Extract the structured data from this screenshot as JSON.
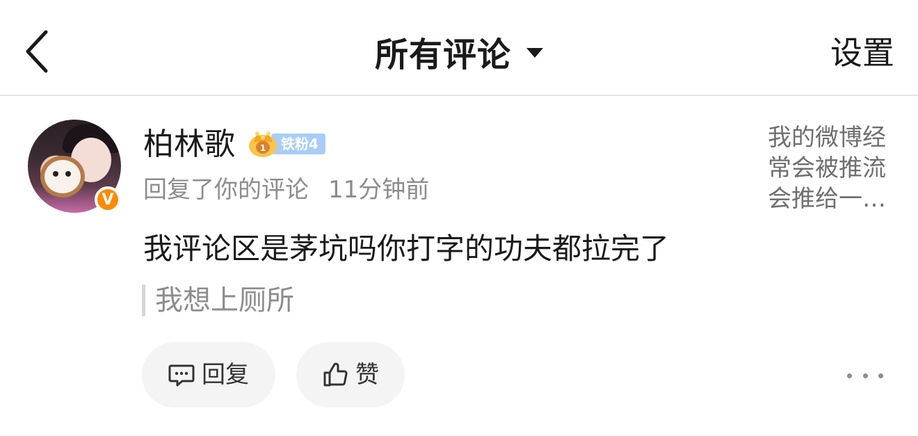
{
  "header": {
    "title": "所有评论",
    "settings_label": "设置",
    "back_icon": "chevron-left-icon",
    "dropdown_icon": "caret-down-icon"
  },
  "comment": {
    "username": "柏林歌",
    "fan_badge": "铁粉4",
    "verified_mark": "V",
    "action_text": "回复了你的评论",
    "time": "11分钟前",
    "content": "我评论区是茅坑吗你打字的功夫都拉完了",
    "quoted": "我想上厕所",
    "original_post_preview": "我的微博经常会被推流会推给一…",
    "reply_label": "回复",
    "like_label": "赞"
  },
  "colors": {
    "verified": "#ff8a00",
    "fan_badge": "#a9cdf6",
    "secondary_text": "#8c8c8c",
    "button_bg": "#f4f4f4"
  }
}
